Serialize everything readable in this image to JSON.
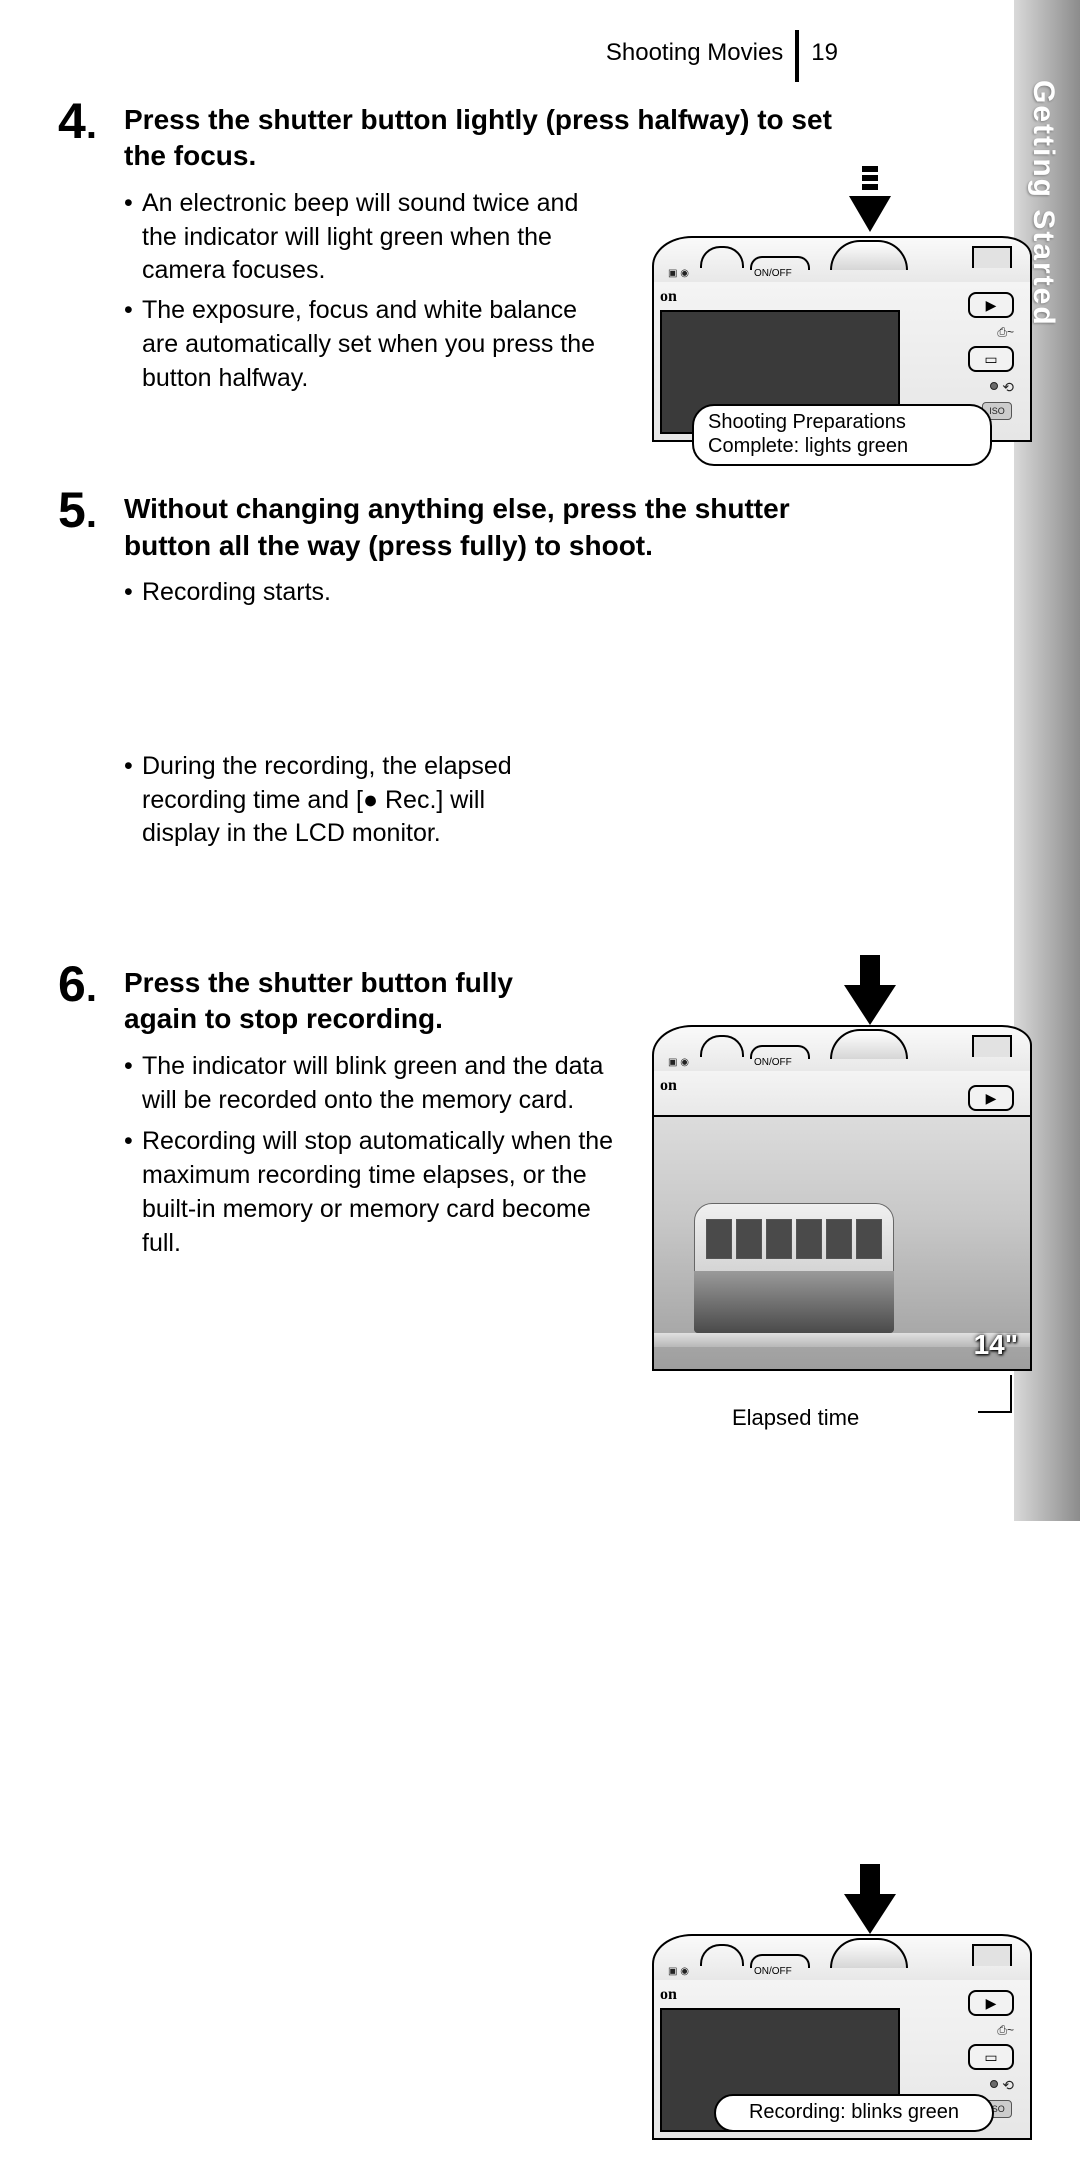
{
  "header": {
    "section": "Shooting Movies",
    "page_num": "19"
  },
  "side_tab": "Getting Started",
  "steps": {
    "s4": {
      "num": "4",
      "head": "Press the shutter button lightly (press halfway) to set the focus.",
      "b1": "An electronic beep will sound twice and the indicator will light green when the camera focuses.",
      "b2": "The exposure, focus and white balance are automatically set when you press the button halfway."
    },
    "s5": {
      "num": "5",
      "head": "Without changing anything else, press the shutter button all the way (press fully) to shoot.",
      "b1": "Recording starts.",
      "b2": "During the recording, the elapsed recording time and [● Rec.] will display in the LCD monitor."
    },
    "s6": {
      "num": "6",
      "head": "Press the shutter button fully again to stop recording.",
      "b1": "The indicator will blink green and the data will be recorded onto the memory card.",
      "b2": "Recording will stop automatically when the maximum recording time elapses, or the built-in memory or memory card become full."
    }
  },
  "diagram": {
    "onoff": "ON/OFF",
    "brand_partial": "on",
    "play_icon": "▶",
    "print_glyph": "⎙~",
    "iso": "ISO",
    "callout1_line1": "Shooting Preparations",
    "callout1_line2": "Complete: lights green",
    "elapsed_value": "14\"",
    "elapsed_caption": "Elapsed time",
    "callout3": "Recording: blinks green"
  }
}
